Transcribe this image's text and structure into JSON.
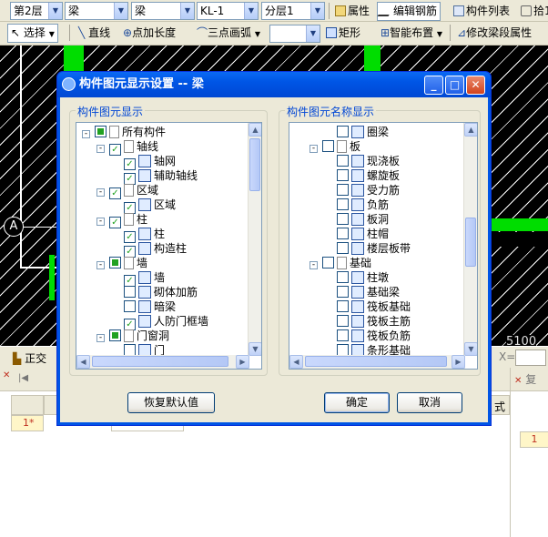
{
  "toolbar1": {
    "floor": "第2层",
    "type": "梁",
    "subtype": "梁",
    "element": "KL-1",
    "layer": "分层1",
    "properties": "属性",
    "edit_rebar": "编辑钢筋",
    "component_list": "构件列表",
    "pick": "拾1"
  },
  "toolbar2": {
    "select": "选择",
    "line": "直线",
    "point_extend": "点加长度",
    "three_point_arc": "三点画弧",
    "rect": "矩形",
    "smart_layout": "智能布置",
    "modify_segment": "修改梁段属性"
  },
  "canvas": {
    "axis_label": "A",
    "coord_text": "5100"
  },
  "status": {
    "ortho": "正交",
    "x_label": "X="
  },
  "bottom": {
    "row_marker": "1*",
    "right_cell": "1",
    "col_partial": "式",
    "right_tab": "复"
  },
  "dialog": {
    "title": "构件图元显示设置 -- 梁",
    "left_group": "构件图元显示",
    "right_group": "构件图元名称显示",
    "restore_label": "恢复默认值",
    "ok_label": "确定",
    "cancel_label": "取消",
    "left_tree": [
      {
        "level": 0,
        "exp": "-",
        "check": "part",
        "label": "所有构件"
      },
      {
        "level": 1,
        "exp": "-",
        "check": "checked",
        "label": "轴线"
      },
      {
        "level": 2,
        "exp": "",
        "check": "checked",
        "label": "轴网",
        "icon": "grid-icon"
      },
      {
        "level": 2,
        "exp": "",
        "check": "checked",
        "label": "辅助轴线",
        "icon": "aux-axis-icon"
      },
      {
        "level": 1,
        "exp": "-",
        "check": "checked",
        "label": "区域"
      },
      {
        "level": 2,
        "exp": "",
        "check": "checked",
        "label": "区域",
        "icon": "area-icon"
      },
      {
        "level": 1,
        "exp": "-",
        "check": "checked",
        "label": "柱"
      },
      {
        "level": 2,
        "exp": "",
        "check": "checked",
        "label": "柱",
        "icon": "column-icon"
      },
      {
        "level": 2,
        "exp": "",
        "check": "checked",
        "label": "构造柱",
        "icon": "constructional-column-icon"
      },
      {
        "level": 1,
        "exp": "-",
        "check": "part",
        "label": "墙"
      },
      {
        "level": 2,
        "exp": "",
        "check": "checked",
        "label": "墙",
        "icon": "wall-icon"
      },
      {
        "level": 2,
        "exp": "",
        "check": "unchecked",
        "label": "砌体加筋",
        "icon": "masonry-rebar-icon"
      },
      {
        "level": 2,
        "exp": "",
        "check": "unchecked",
        "label": "暗梁",
        "icon": "hidden-beam-icon"
      },
      {
        "level": 2,
        "exp": "",
        "check": "checked",
        "label": "人防门框墙",
        "icon": "door-frame-wall-icon"
      },
      {
        "level": 1,
        "exp": "-",
        "check": "part",
        "label": "门窗洞"
      },
      {
        "level": 2,
        "exp": "",
        "check": "unchecked",
        "label": "门",
        "icon": "door-icon"
      }
    ],
    "right_tree": [
      {
        "level": 2,
        "exp": "",
        "check": "unchecked",
        "label": "圈梁",
        "icon": "ring-beam-icon"
      },
      {
        "level": 1,
        "exp": "-",
        "check": "unchecked",
        "label": "板"
      },
      {
        "level": 2,
        "exp": "",
        "check": "unchecked",
        "label": "现浇板",
        "icon": "cast-slab-icon"
      },
      {
        "level": 2,
        "exp": "",
        "check": "unchecked",
        "label": "螺旋板",
        "icon": "spiral-slab-icon"
      },
      {
        "level": 2,
        "exp": "",
        "check": "unchecked",
        "label": "受力筋",
        "icon": "stress-rebar-icon"
      },
      {
        "level": 2,
        "exp": "",
        "check": "unchecked",
        "label": "负筋",
        "icon": "negative-rebar-icon"
      },
      {
        "level": 2,
        "exp": "",
        "check": "unchecked",
        "label": "板洞",
        "icon": "slab-hole-icon"
      },
      {
        "level": 2,
        "exp": "",
        "check": "unchecked",
        "label": "柱帽",
        "icon": "column-cap-icon"
      },
      {
        "level": 2,
        "exp": "",
        "check": "unchecked",
        "label": "楼层板带",
        "icon": "slab-strip-icon"
      },
      {
        "level": 1,
        "exp": "-",
        "check": "unchecked",
        "label": "基础"
      },
      {
        "level": 2,
        "exp": "",
        "check": "unchecked",
        "label": "柱墩",
        "icon": "column-pier-icon"
      },
      {
        "level": 2,
        "exp": "",
        "check": "unchecked",
        "label": "基础梁",
        "icon": "foundation-beam-icon"
      },
      {
        "level": 2,
        "exp": "",
        "check": "unchecked",
        "label": "筏板基础",
        "icon": "raft-foundation-icon"
      },
      {
        "level": 2,
        "exp": "",
        "check": "unchecked",
        "label": "筏板主筋",
        "icon": "raft-main-rebar-icon"
      },
      {
        "level": 2,
        "exp": "",
        "check": "unchecked",
        "label": "筏板负筋",
        "icon": "raft-negative-rebar-icon"
      },
      {
        "level": 2,
        "exp": "",
        "check": "unchecked",
        "label": "条形基础",
        "icon": "strip-foundation-icon"
      }
    ]
  }
}
